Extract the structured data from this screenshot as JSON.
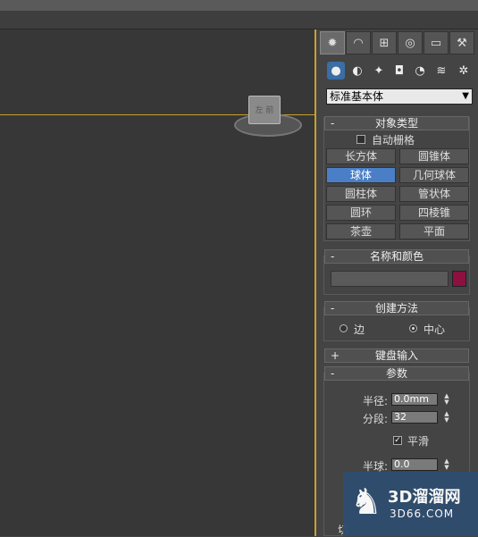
{
  "tabs": [
    {
      "name": "create",
      "glyph": "✹"
    },
    {
      "name": "modify",
      "glyph": "◠"
    },
    {
      "name": "hierarchy",
      "glyph": "⊞"
    },
    {
      "name": "motion",
      "glyph": "◎"
    },
    {
      "name": "display",
      "glyph": "▭"
    },
    {
      "name": "utilities",
      "glyph": "⚒"
    }
  ],
  "subcategories": [
    {
      "name": "geometry",
      "glyph": "●"
    },
    {
      "name": "shapes",
      "glyph": "◐"
    },
    {
      "name": "lights",
      "glyph": "✦"
    },
    {
      "name": "cameras",
      "glyph": "◘"
    },
    {
      "name": "helpers",
      "glyph": "◔"
    },
    {
      "name": "spacewarps",
      "glyph": "≋"
    },
    {
      "name": "systems",
      "glyph": "✲"
    }
  ],
  "category_dropdown": {
    "value": "标准基本体"
  },
  "object_type": {
    "title": "对象类型",
    "sign": "-",
    "auto_grid": "自动栅格",
    "buttons": [
      "长方体",
      "圆锥体",
      "球体",
      "几何球体",
      "圆柱体",
      "管状体",
      "圆环",
      "四棱锥",
      "茶壶",
      "平面"
    ],
    "active_button": "球体"
  },
  "name_color": {
    "title": "名称和颜色",
    "sign": "-",
    "name_value": "",
    "color": "#8c1040"
  },
  "creation_method": {
    "title": "创建方法",
    "sign": "-",
    "options": [
      "边",
      "中心"
    ],
    "selected": "中心"
  },
  "keyboard_entry": {
    "title": "键盘输入",
    "sign": "+"
  },
  "parameters": {
    "title": "参数",
    "sign": "-",
    "radius_label": "半径:",
    "radius_value": "0.0mm",
    "segments_label": "分段:",
    "segments_value": "32",
    "smooth_label": "平滑",
    "smooth_checked": true,
    "hemisphere_label": "半球:",
    "hemisphere_value": "0.0",
    "partial_char": "切"
  },
  "viewcube": {
    "label": "左 前"
  },
  "watermark": {
    "title": "3D溜溜网",
    "url": "3D66.COM"
  }
}
